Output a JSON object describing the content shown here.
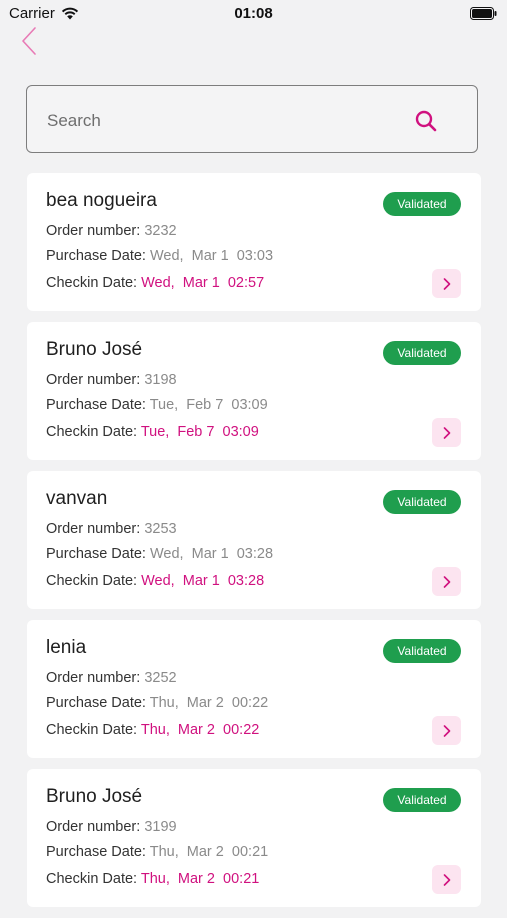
{
  "status_bar": {
    "carrier": "Carrier",
    "time": "01:08"
  },
  "search": {
    "placeholder": "Search"
  },
  "colors": {
    "accent": "#d0117f",
    "validated": "#1f9e4e",
    "background": "#f2f2f3"
  },
  "labels": {
    "order_number": "Order number: ",
    "purchase_date": "Purchase Date: ",
    "checkin_date": "Checkin Date: "
  },
  "orders": [
    {
      "name": "bea nogueira",
      "status": "Validated",
      "order_number": "3232",
      "purchase_date": "Wed,  Mar 1  03:03",
      "checkin_date": "Wed,  Mar 1  02:57"
    },
    {
      "name": "Bruno José",
      "status": "Validated",
      "order_number": "3198",
      "purchase_date": "Tue,  Feb 7  03:09",
      "checkin_date": "Tue,  Feb 7  03:09"
    },
    {
      "name": "vanvan",
      "status": "Validated",
      "order_number": "3253",
      "purchase_date": "Wed,  Mar 1  03:28",
      "checkin_date": "Wed,  Mar 1  03:28"
    },
    {
      "name": "lenia",
      "status": "Validated",
      "order_number": "3252",
      "purchase_date": "Thu,  Mar 2  00:22",
      "checkin_date": "Thu,  Mar 2  00:22"
    },
    {
      "name": "Bruno José",
      "status": "Validated",
      "order_number": "3199",
      "purchase_date": "Thu,  Mar 2  00:21",
      "checkin_date": "Thu,  Mar 2  00:21"
    }
  ]
}
